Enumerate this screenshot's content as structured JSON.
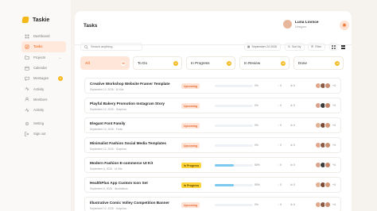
{
  "app": {
    "name": "Taskie"
  },
  "sidebar": {
    "items": [
      {
        "label": "Dashboard",
        "icon": "grid-icon"
      },
      {
        "label": "Tasks",
        "icon": "task-icon",
        "active": true
      },
      {
        "label": "Projects",
        "icon": "folder-icon",
        "caret": "⌄"
      },
      {
        "label": "Calendar",
        "icon": "calendar-icon"
      },
      {
        "label": "Messages",
        "icon": "message-icon",
        "badge": "4"
      },
      {
        "label": "Activity",
        "icon": "activity-icon"
      },
      {
        "label": "Members",
        "icon": "members-icon"
      },
      {
        "label": "Activity",
        "icon": "activity-icon"
      },
      {
        "label": "Setting",
        "icon": "gear-icon"
      },
      {
        "label": "Sign out",
        "icon": "signout-icon"
      }
    ]
  },
  "header": {
    "title": "Tasks",
    "user_name": "Luna Lovnce",
    "user_role": "Designer"
  },
  "toolbar": {
    "search_placeholder": "Search anything",
    "date": "September 24 2026",
    "sort_label": "Sort by",
    "filter_label": "Filter"
  },
  "tabs": [
    {
      "label": "All",
      "count": "08"
    },
    {
      "label": "To Do",
      "count": "12"
    },
    {
      "label": "In Progress",
      "count": "16"
    },
    {
      "label": "In Review",
      "count": "16"
    },
    {
      "label": "Done",
      "count": "16"
    }
  ],
  "tasks": [
    {
      "title": "Creative Workshop Website Framer Template",
      "date": "September 12, 2026",
      "category": "UI Kits",
      "status": "Upcoming",
      "progress": 0,
      "pct": "0%",
      "comments": "0",
      "attachments": "0",
      "more": "+4"
    },
    {
      "title": "Playful Bakery Promotion Instagram Story",
      "date": "September 12, 2026",
      "category": "Graphics",
      "status": "Upcoming",
      "progress": 0,
      "pct": "0%",
      "comments": "0",
      "attachments": "0",
      "more": "+4"
    },
    {
      "title": "Elegant Font Family",
      "date": "September 12, 2026",
      "category": "Fonts",
      "status": "Upcoming",
      "progress": 0,
      "pct": "0%",
      "comments": "0",
      "attachments": "0",
      "more": "+4"
    },
    {
      "title": "Minimalist Fashion Social Media Templates",
      "date": "September 12, 2026",
      "category": "Graphics",
      "status": "Upcoming",
      "progress": 0,
      "pct": "0%",
      "comments": "0",
      "attachments": "0",
      "more": "+4"
    },
    {
      "title": "Modern Fashion E-commerce UI Kit",
      "date": "September 6, 2026",
      "category": "UI Kits",
      "status": "In Progress",
      "progress": 50,
      "pct": "50%",
      "comments": "0",
      "attachments": "0",
      "more": "+4"
    },
    {
      "title": "HealthPlus App Custom Icon Set",
      "date": "September 6, 2026",
      "category": "Illustrations",
      "status": "In Progress",
      "progress": 50,
      "pct": "50%",
      "comments": "0",
      "attachments": "0",
      "more": "+4"
    },
    {
      "title": "Illustrative Comic Volley Competition Banner",
      "date": "September 12, 2026",
      "category": "Graphics",
      "status": "Upcoming",
      "progress": 0,
      "pct": "0%",
      "comments": "0",
      "attachments": "0",
      "more": "+4"
    }
  ],
  "colors": {
    "accent": "#f57c3a",
    "accent_light": "#ffe6d9",
    "yellow": "#f5b819",
    "progress_blue": "#7cc9ef"
  }
}
